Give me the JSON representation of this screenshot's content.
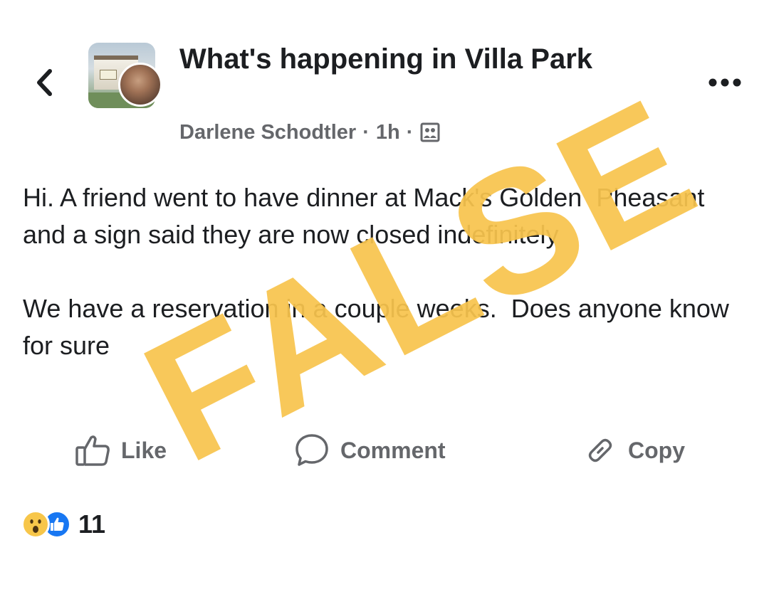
{
  "header": {
    "back_icon": "chevron-left-icon",
    "group_name": "What's happening in Villa Park",
    "author": "Darlene Schodtler",
    "separator": "·",
    "time": "1h",
    "audience_icon": "group-members-icon",
    "more_icon": "more-horizontal-icon"
  },
  "post": {
    "paragraphs": [
      "Hi. A friend went to have dinner at Mack's Golden  Pheasant and a sign said they are now closed indefinitely",
      "We have a reservation in a couple weeks.  Does anyone know for sure"
    ]
  },
  "actions": {
    "like": {
      "label": "Like",
      "icon": "thumbs-up-icon"
    },
    "comment": {
      "label": "Comment",
      "icon": "comment-bubble-icon"
    },
    "copy": {
      "label": "Copy",
      "icon": "link-icon"
    }
  },
  "reactions": {
    "icons": [
      "wow-reaction-icon",
      "like-reaction-icon"
    ],
    "count": "11"
  },
  "overlay": {
    "stamp_text": "FALSE",
    "stamp_color": "#F8C44E"
  },
  "colors": {
    "text_primary": "#1c1e21",
    "text_secondary": "#65676b",
    "like_blue": "#1877f2",
    "wow_yellow": "#f7c64a"
  }
}
